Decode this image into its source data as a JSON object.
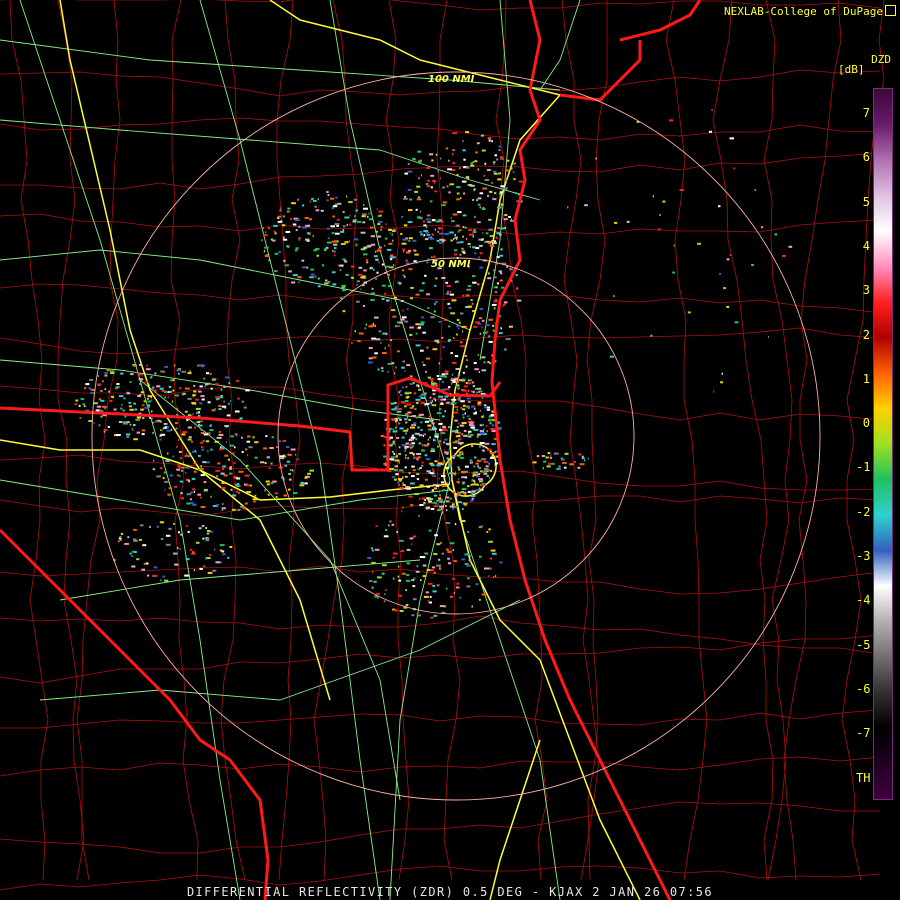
{
  "header": {
    "credit": "NEXLAB-College of DuPage",
    "credit_icon": "external-link-icon"
  },
  "caption": "DIFFERENTIAL REFLECTIVITY (ZDR) 0.5 DEG - KJAX 2 JAN 26 07:56",
  "legend": {
    "title": "DZD",
    "unit": "[dB]",
    "ticks": [
      "7",
      "6",
      "5",
      "4",
      "3",
      "2",
      "1",
      "0",
      "-1",
      "-2",
      "-3",
      "-4",
      "-5",
      "-6",
      "-7",
      "TH"
    ],
    "colors": [
      "#3a0a3a",
      "#6a1a6a",
      "#b070b0",
      "#e0c0e0",
      "#ffffff",
      "#ff90c0",
      "#ff2020",
      "#b00000",
      "#ff6000",
      "#ffd000",
      "#a0e020",
      "#20c060",
      "#30d0d0",
      "#3060c0",
      "#ffffff",
      "#b0b0b0",
      "#707070",
      "#303030",
      "#000000",
      "#200020",
      "#400040"
    ]
  },
  "map": {
    "range_rings": [
      "50 NMI",
      "100 NMI"
    ],
    "colors": {
      "state_boundary": "#ff1a1a",
      "county_boundary": "#b01010",
      "interstate": "#ffff33",
      "highway": "#88ee88",
      "range_ring": "#ffb0a0"
    }
  }
}
